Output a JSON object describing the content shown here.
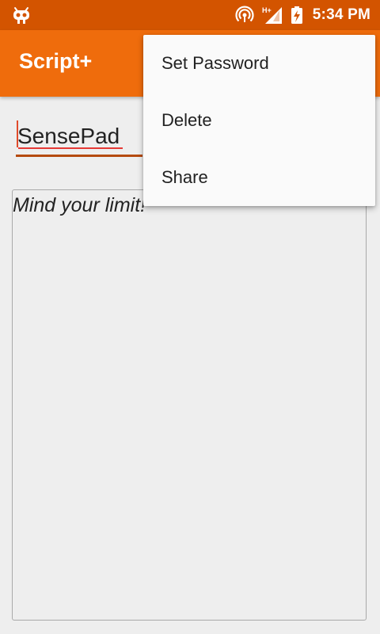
{
  "status_bar": {
    "time": "5:34 PM",
    "icons": [
      "android-debug-icon",
      "hotspot-icon",
      "signal-hplus-icon",
      "battery-charging-icon"
    ],
    "network_label": "H+"
  },
  "app_bar": {
    "title": "Script+"
  },
  "editor": {
    "title_value": "SensePad",
    "body_hint": "Mind your limit!"
  },
  "overflow_menu": {
    "items": [
      {
        "label": "Set Password"
      },
      {
        "label": "Delete"
      },
      {
        "label": "Share"
      }
    ]
  },
  "colors": {
    "status_bar": "#d35400",
    "app_bar": "#ef6c0c",
    "accent_underline": "#b54a0f",
    "spell_check": "#e53935"
  }
}
